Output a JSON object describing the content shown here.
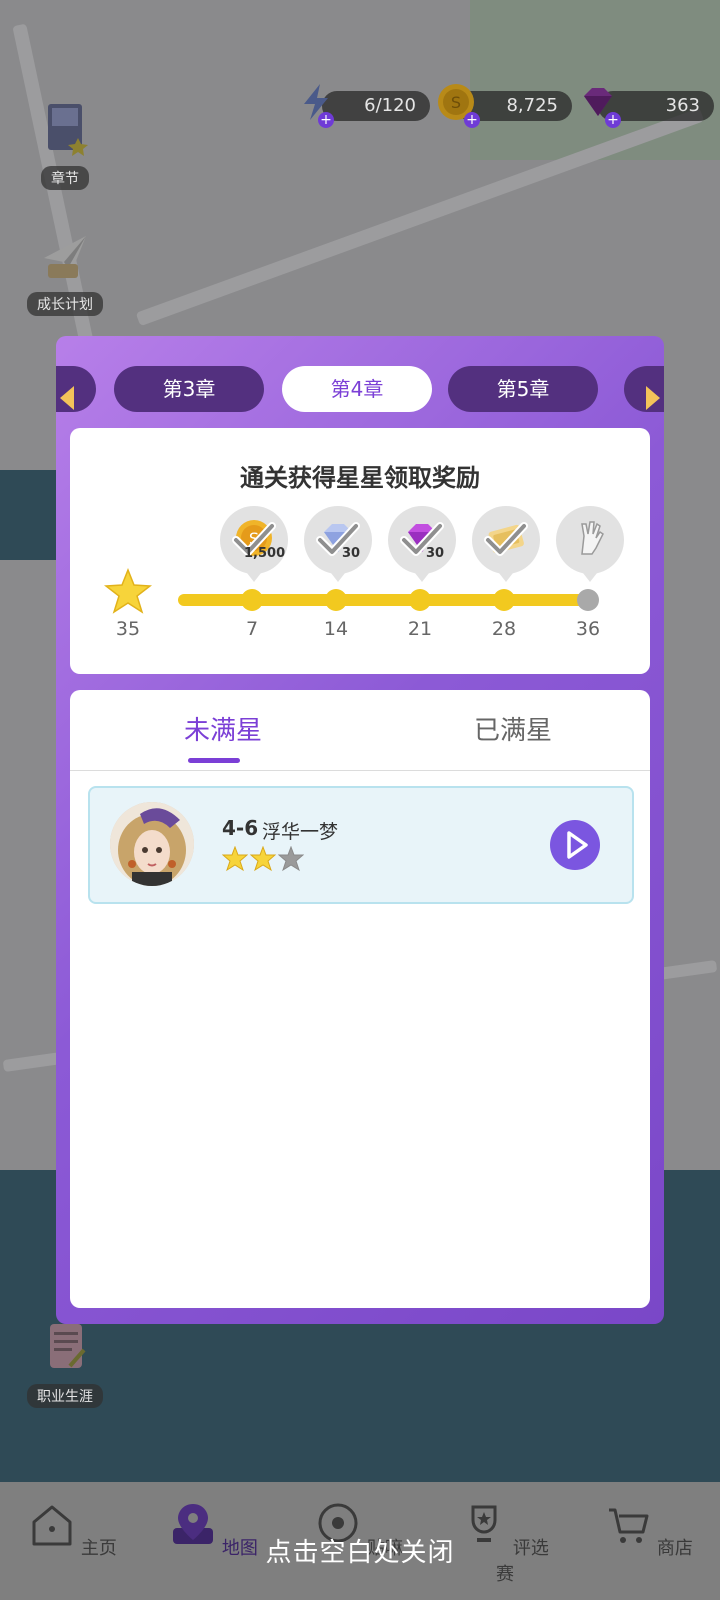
{
  "resources": {
    "energy": {
      "value": "6/120",
      "icon": "lightning-icon"
    },
    "coins": {
      "value": "8,725",
      "icon": "coin-icon"
    },
    "gems": {
      "value": "363",
      "icon": "gem-icon"
    }
  },
  "side_menu": {
    "chapter_label": "章节",
    "growth_plan_label": "成长计划",
    "career_label": "职业生涯"
  },
  "chapters": [
    {
      "label": "第3章",
      "active": false
    },
    {
      "label": "第4章",
      "active": true
    },
    {
      "label": "第5章",
      "active": false
    }
  ],
  "reward_panel": {
    "title": "通关获得星星领取奖励",
    "current_stars": "35",
    "milestones": [
      {
        "stars": "7",
        "qty": "1,500",
        "item": "coin",
        "claimed": true
      },
      {
        "stars": "14",
        "qty": "30",
        "item": "diamond",
        "claimed": true
      },
      {
        "stars": "21",
        "qty": "30",
        "item": "gem",
        "claimed": true
      },
      {
        "stars": "28",
        "qty": "",
        "item": "ticket",
        "claimed": true
      },
      {
        "stars": "36",
        "qty": "",
        "item": "glove",
        "claimed": false
      }
    ]
  },
  "list_tabs": {
    "unfilled": "未满星",
    "filled": "已满星"
  },
  "stages": [
    {
      "code": "4-6",
      "name": "浮华一梦",
      "stars_earned": 2,
      "stars_total": 3
    }
  ],
  "bottom_nav": [
    {
      "label": "主页",
      "icon": "home-icon"
    },
    {
      "label": "地图",
      "icon": "map-pin-icon"
    },
    {
      "label": "贴嘛",
      "icon": "sticker-icon"
    },
    {
      "label": "评选赛",
      "icon": "trophy-icon"
    },
    {
      "label": "商店",
      "icon": "cart-icon"
    }
  ],
  "close_hint": "点击空白处关闭",
  "colors": {
    "accent": "#7b3fd6",
    "track": "#f2c91f",
    "modal_bg": "#8c5ad6"
  }
}
